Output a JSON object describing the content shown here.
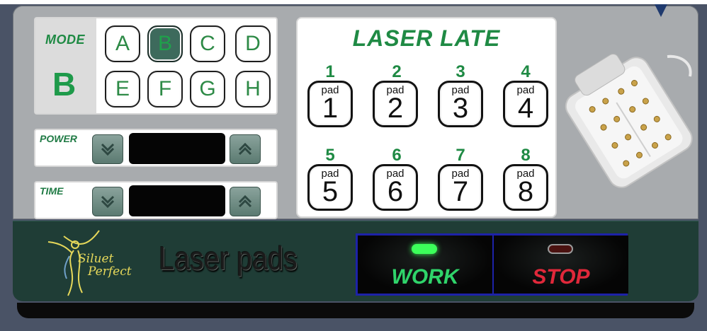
{
  "app": {
    "brand_title": "Laser pads",
    "logo_line1": "Siluet",
    "logo_line2": "Perfect"
  },
  "mode": {
    "label": "MODE",
    "current": "B",
    "buttons": [
      "A",
      "B",
      "C",
      "D",
      "E",
      "F",
      "G",
      "H"
    ],
    "selected": "B"
  },
  "power": {
    "label": "POWER",
    "display_value": "",
    "down_icon": "chevron-double-down-icon",
    "up_icon": "chevron-double-up-icon"
  },
  "time": {
    "label": "TIME",
    "display_value": "",
    "down_icon": "chevron-double-down-icon",
    "up_icon": "chevron-double-up-icon"
  },
  "pads": {
    "title": "LASER LATE",
    "items": [
      {
        "number": "1",
        "word": "pad",
        "digit": "1"
      },
      {
        "number": "2",
        "word": "pad",
        "digit": "2"
      },
      {
        "number": "3",
        "word": "pad",
        "digit": "3"
      },
      {
        "number": "4",
        "word": "pad",
        "digit": "4"
      },
      {
        "number": "5",
        "word": "pad",
        "digit": "5"
      },
      {
        "number": "6",
        "word": "pad",
        "digit": "6"
      },
      {
        "number": "7",
        "word": "pad",
        "digit": "7"
      },
      {
        "number": "8",
        "word": "pad",
        "digit": "8"
      }
    ]
  },
  "controls": {
    "work_label": "WORK",
    "stop_label": "STOP",
    "work_led_color": "#3cff5a",
    "stop_led_color": "#4a1210",
    "work_text_color": "#2fd46a",
    "stop_text_color": "#e0283a"
  },
  "colors": {
    "accent_green": "#1f8a44",
    "panel_bg": "#a8abae",
    "bottom_bar": "#1f3d36",
    "frame_blue": "#1d22a8"
  }
}
